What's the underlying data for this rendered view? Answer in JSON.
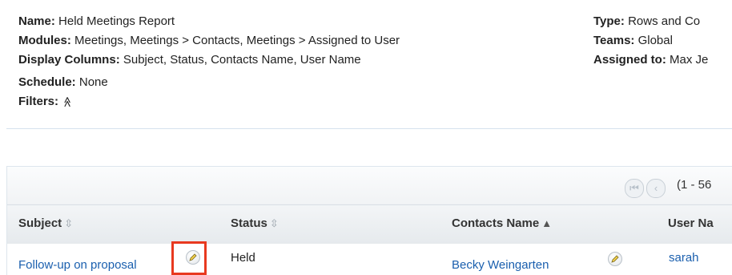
{
  "summary": {
    "name_label": "Name:",
    "name_value": " Held Meetings Report",
    "modules_label": "Modules:",
    "modules_value": " Meetings, Meetings > Contacts, Meetings > Assigned to User",
    "columns_label": "Display Columns:",
    "columns_value": " Subject, Status, Contacts Name, User Name",
    "schedule_label": "Schedule:",
    "schedule_value": " None",
    "filters_label": "Filters:",
    "filters_toggle": "≪",
    "type_label": "Type:",
    "type_value": " Rows and Co",
    "teams_label": "Teams:",
    "teams_value": " Global",
    "assigned_label": "Assigned to:",
    "assigned_value": " Max Je"
  },
  "pager": {
    "first_icon": "first-page-icon",
    "prev_icon": "prev-page-icon",
    "range": "(1 - 56"
  },
  "table": {
    "columns": [
      {
        "label": "Subject",
        "sort": "⇳"
      },
      {
        "label": "Status",
        "sort": "⇳"
      },
      {
        "label": "Contacts Name",
        "sort": "⇳"
      },
      {
        "label": "User Na",
        "sort": ""
      }
    ],
    "rows": [
      {
        "subject": "Follow-up on proposal",
        "status": "Held",
        "contact": "Becky Weingarten",
        "user": "sarah"
      }
    ]
  },
  "colors": {
    "link": "#1a5fae",
    "highlight": "#e8391f"
  }
}
